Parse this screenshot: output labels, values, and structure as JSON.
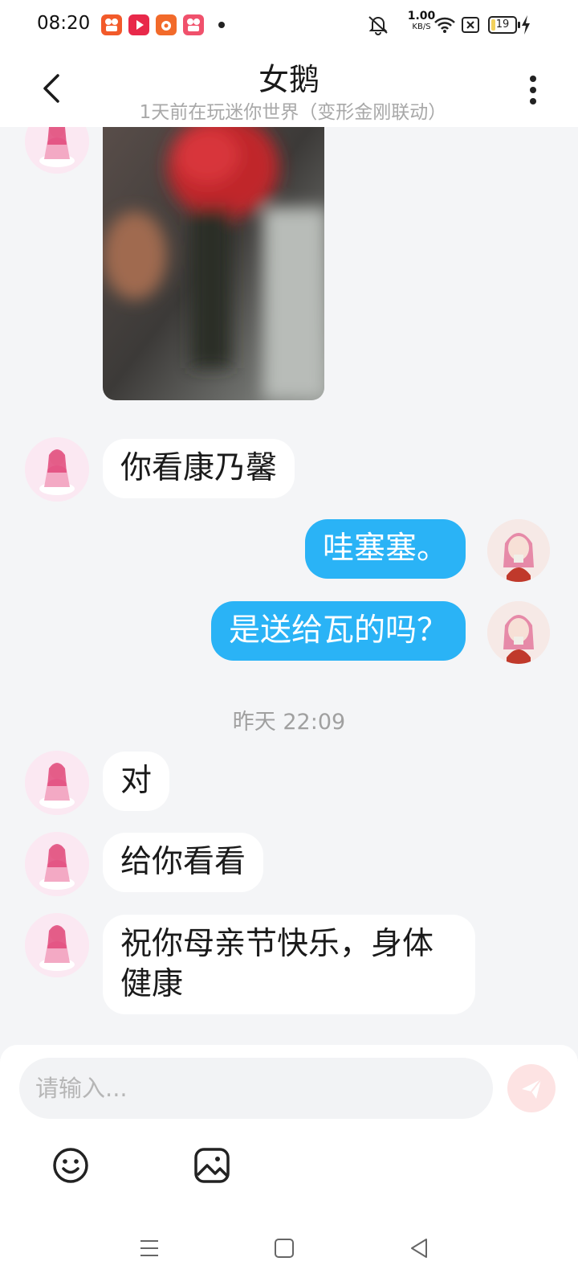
{
  "status_bar": {
    "time": "08:20",
    "network_speed_value": "1.00",
    "network_speed_unit": "KB/S",
    "battery_level": "19",
    "icons": [
      "app-icon-kuaishou",
      "app-icon-video",
      "app-icon-game",
      "app-icon-kuaishou-2",
      "notification-dot",
      "mute-icon",
      "wifi-icon",
      "no-sim-icon",
      "battery-icon",
      "charging-icon"
    ]
  },
  "header": {
    "title": "女鹅",
    "subtitle": "1天前在玩迷你世界（变形金刚联动）"
  },
  "messages": [
    {
      "side": "in",
      "type": "image"
    },
    {
      "side": "in",
      "type": "text",
      "text": "你看康乃馨"
    },
    {
      "side": "out",
      "type": "text",
      "text": "哇塞塞。"
    },
    {
      "side": "out",
      "type": "text",
      "text": "是送给瓦的吗？"
    },
    {
      "type": "timestamp",
      "text": "昨天 22:09"
    },
    {
      "side": "in",
      "type": "text",
      "text": "对"
    },
    {
      "side": "in",
      "type": "text",
      "text": "给你看看"
    },
    {
      "side": "in",
      "type": "text",
      "text": "祝你母亲节快乐，身体",
      "line2": "健康"
    }
  ],
  "input": {
    "placeholder": "请输入..."
  },
  "colors": {
    "outgoing_bubble": "#2ab3f6",
    "incoming_bubble": "#ffffff",
    "background": "#f4f5f7",
    "send_button": "#fde3e3"
  }
}
